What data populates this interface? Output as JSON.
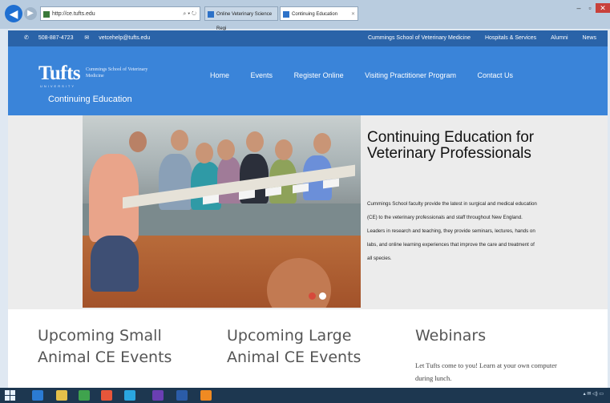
{
  "browser": {
    "url": "http://ce.tufts.edu",
    "tabs": [
      {
        "label": "Online Veterinary Science Regi"
      },
      {
        "label": "Continuing Education"
      }
    ],
    "window_controls": {
      "minimize": "–",
      "maximize": "▫",
      "close": "✕"
    }
  },
  "site": {
    "topbar": {
      "phone": "508-887-4723",
      "email": "vetcehelp@tufts.edu",
      "links": [
        "Cummings School of Veterinary Medicine",
        "Hospitals & Services",
        "Alumni",
        "News"
      ]
    },
    "logo": {
      "wordmark": "Tufts",
      "subtitle": "Cummings School of Veterinary Medicine",
      "university": "UNIVERSITY"
    },
    "section_label": "Continuing Education",
    "nav": [
      "Home",
      "Events",
      "Register Online",
      "Visiting Practitioner Program",
      "Contact Us"
    ],
    "hero": {
      "title": "Continuing Education for Veterinary Professionals",
      "body": "Cummings School faculty provide the latest in surgical and medical education (CE) to the veterinary professionals and staff throughout New England. Leaders in research and teaching, they provide seminars, lectures, hands on labs, and online learning experiences that improve the care and treatment of all species.",
      "slides": 2,
      "active_slide": 1
    },
    "columns": [
      {
        "title": "Upcoming Small Animal CE Events"
      },
      {
        "title": "Upcoming Large Animal CE Events"
      },
      {
        "title": "Webinars",
        "text": "Let Tufts come to you! Learn at your own computer during lunch."
      }
    ]
  },
  "taskbar": {
    "icons": [
      "windows-start-icon",
      "ie-icon",
      "file-explorer-icon",
      "store-icon",
      "chrome-icon",
      "skype-icon",
      "mail-icon",
      "word-icon",
      "firefox-icon"
    ],
    "colors": [
      "#2b7bd3",
      "#e4c04a",
      "#3fa34d",
      "#e7563a",
      "#2aa5df",
      "#6a3fb3",
      "#2b5ca8",
      "#f08a22"
    ]
  },
  "colors": {
    "header_blue": "#3a84d9",
    "topbar_blue": "#2a63a8",
    "accent_red": "#d64a3b"
  }
}
